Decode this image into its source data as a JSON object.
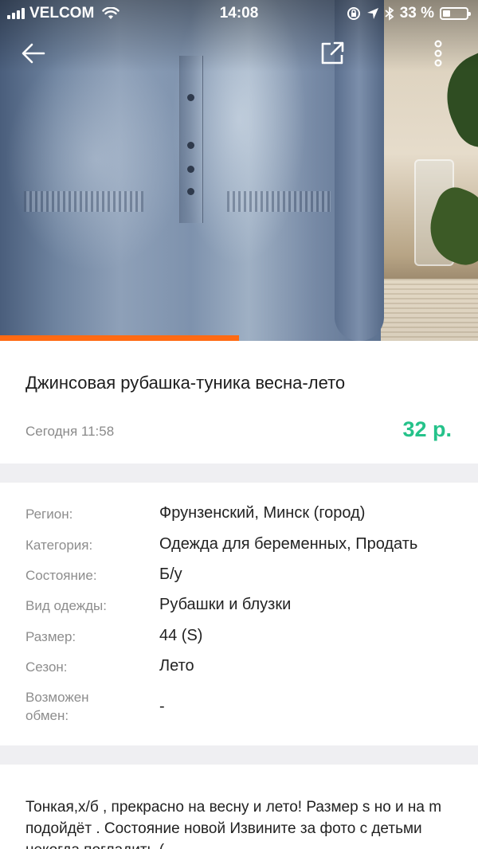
{
  "status_bar": {
    "carrier": "VELCOM",
    "time": "14:08",
    "battery": "33 %",
    "battery_level": 0.33,
    "icons": [
      "signal-icon",
      "wifi-icon",
      "lock-rotation-icon",
      "location-icon",
      "bluetooth-icon",
      "battery-icon"
    ]
  },
  "header": {
    "icons": [
      "back-arrow-icon",
      "share-icon",
      "more-vertical-icon"
    ]
  },
  "gallery": {
    "progress_fraction": 0.5,
    "accent_color": "#ff6a13"
  },
  "listing": {
    "title": "Джинсовая рубашка-туника весна-лето",
    "date": "Сегодня 11:58",
    "price": "32 р.",
    "price_color": "#25c28a"
  },
  "properties": [
    {
      "label": "Регион:",
      "value": "Фрунзенский, Минск (город)"
    },
    {
      "label": "Категория:",
      "value": "Одежда для беременных, Продать"
    },
    {
      "label": "Состояние:",
      "value": "Б/у"
    },
    {
      "label": "Вид одежды:",
      "value": "Рубашки и блузки"
    },
    {
      "label": "Размер:",
      "value": "44 (S)"
    },
    {
      "label": "Сезон:",
      "value": "Лето"
    },
    {
      "label": "Возможен обмен:",
      "value": "-"
    }
  ],
  "description": {
    "text": "Тонкая,х/б , прекрасно на весну и лето! Размер s но и на m подойдёт . Состояние новой Извините за фото с детьми некогда погладить ("
  }
}
